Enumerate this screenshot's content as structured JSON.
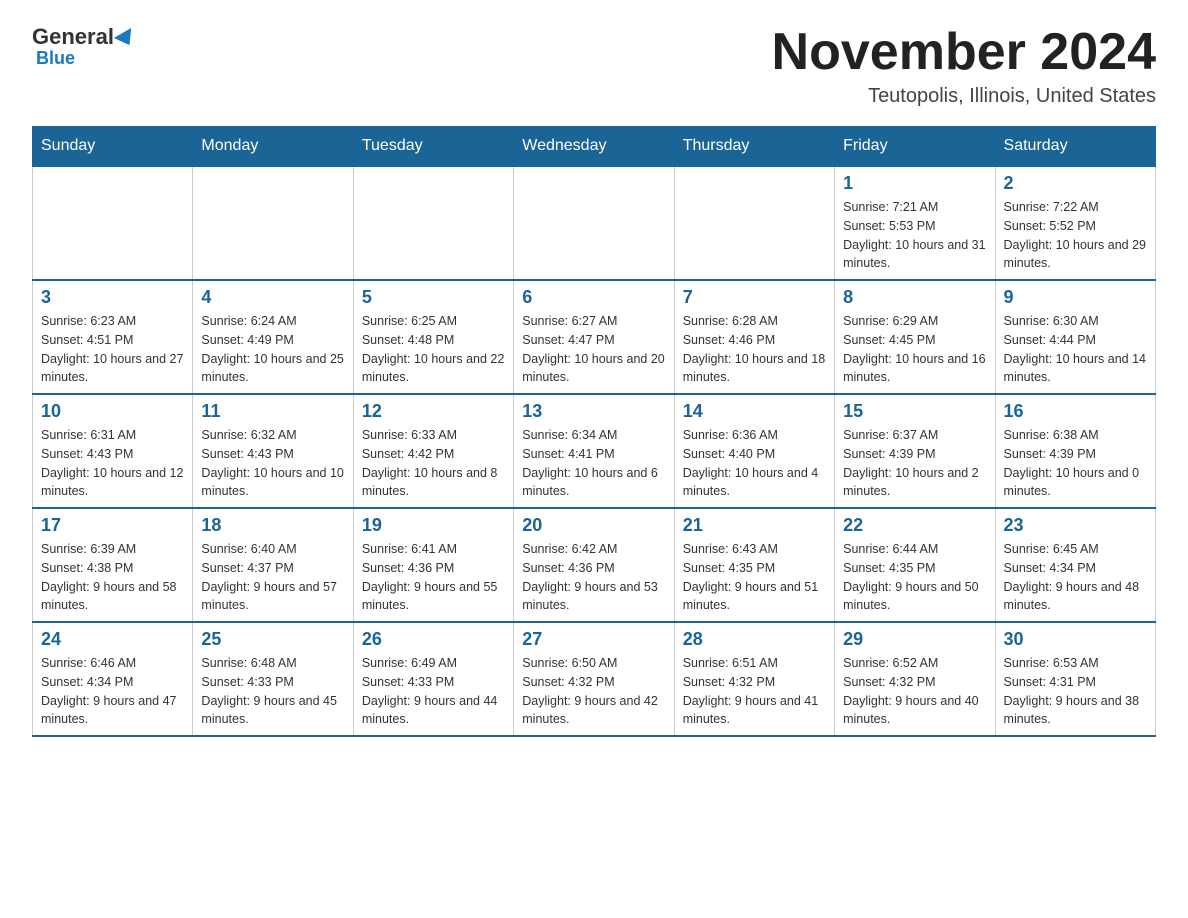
{
  "header": {
    "logo_general": "General",
    "logo_blue": "Blue",
    "month_title": "November 2024",
    "location": "Teutopolis, Illinois, United States"
  },
  "days_of_week": [
    "Sunday",
    "Monday",
    "Tuesday",
    "Wednesday",
    "Thursday",
    "Friday",
    "Saturday"
  ],
  "weeks": [
    [
      {
        "day": "",
        "info": ""
      },
      {
        "day": "",
        "info": ""
      },
      {
        "day": "",
        "info": ""
      },
      {
        "day": "",
        "info": ""
      },
      {
        "day": "",
        "info": ""
      },
      {
        "day": "1",
        "info": "Sunrise: 7:21 AM\nSunset: 5:53 PM\nDaylight: 10 hours and 31 minutes."
      },
      {
        "day": "2",
        "info": "Sunrise: 7:22 AM\nSunset: 5:52 PM\nDaylight: 10 hours and 29 minutes."
      }
    ],
    [
      {
        "day": "3",
        "info": "Sunrise: 6:23 AM\nSunset: 4:51 PM\nDaylight: 10 hours and 27 minutes."
      },
      {
        "day": "4",
        "info": "Sunrise: 6:24 AM\nSunset: 4:49 PM\nDaylight: 10 hours and 25 minutes."
      },
      {
        "day": "5",
        "info": "Sunrise: 6:25 AM\nSunset: 4:48 PM\nDaylight: 10 hours and 22 minutes."
      },
      {
        "day": "6",
        "info": "Sunrise: 6:27 AM\nSunset: 4:47 PM\nDaylight: 10 hours and 20 minutes."
      },
      {
        "day": "7",
        "info": "Sunrise: 6:28 AM\nSunset: 4:46 PM\nDaylight: 10 hours and 18 minutes."
      },
      {
        "day": "8",
        "info": "Sunrise: 6:29 AM\nSunset: 4:45 PM\nDaylight: 10 hours and 16 minutes."
      },
      {
        "day": "9",
        "info": "Sunrise: 6:30 AM\nSunset: 4:44 PM\nDaylight: 10 hours and 14 minutes."
      }
    ],
    [
      {
        "day": "10",
        "info": "Sunrise: 6:31 AM\nSunset: 4:43 PM\nDaylight: 10 hours and 12 minutes."
      },
      {
        "day": "11",
        "info": "Sunrise: 6:32 AM\nSunset: 4:43 PM\nDaylight: 10 hours and 10 minutes."
      },
      {
        "day": "12",
        "info": "Sunrise: 6:33 AM\nSunset: 4:42 PM\nDaylight: 10 hours and 8 minutes."
      },
      {
        "day": "13",
        "info": "Sunrise: 6:34 AM\nSunset: 4:41 PM\nDaylight: 10 hours and 6 minutes."
      },
      {
        "day": "14",
        "info": "Sunrise: 6:36 AM\nSunset: 4:40 PM\nDaylight: 10 hours and 4 minutes."
      },
      {
        "day": "15",
        "info": "Sunrise: 6:37 AM\nSunset: 4:39 PM\nDaylight: 10 hours and 2 minutes."
      },
      {
        "day": "16",
        "info": "Sunrise: 6:38 AM\nSunset: 4:39 PM\nDaylight: 10 hours and 0 minutes."
      }
    ],
    [
      {
        "day": "17",
        "info": "Sunrise: 6:39 AM\nSunset: 4:38 PM\nDaylight: 9 hours and 58 minutes."
      },
      {
        "day": "18",
        "info": "Sunrise: 6:40 AM\nSunset: 4:37 PM\nDaylight: 9 hours and 57 minutes."
      },
      {
        "day": "19",
        "info": "Sunrise: 6:41 AM\nSunset: 4:36 PM\nDaylight: 9 hours and 55 minutes."
      },
      {
        "day": "20",
        "info": "Sunrise: 6:42 AM\nSunset: 4:36 PM\nDaylight: 9 hours and 53 minutes."
      },
      {
        "day": "21",
        "info": "Sunrise: 6:43 AM\nSunset: 4:35 PM\nDaylight: 9 hours and 51 minutes."
      },
      {
        "day": "22",
        "info": "Sunrise: 6:44 AM\nSunset: 4:35 PM\nDaylight: 9 hours and 50 minutes."
      },
      {
        "day": "23",
        "info": "Sunrise: 6:45 AM\nSunset: 4:34 PM\nDaylight: 9 hours and 48 minutes."
      }
    ],
    [
      {
        "day": "24",
        "info": "Sunrise: 6:46 AM\nSunset: 4:34 PM\nDaylight: 9 hours and 47 minutes."
      },
      {
        "day": "25",
        "info": "Sunrise: 6:48 AM\nSunset: 4:33 PM\nDaylight: 9 hours and 45 minutes."
      },
      {
        "day": "26",
        "info": "Sunrise: 6:49 AM\nSunset: 4:33 PM\nDaylight: 9 hours and 44 minutes."
      },
      {
        "day": "27",
        "info": "Sunrise: 6:50 AM\nSunset: 4:32 PM\nDaylight: 9 hours and 42 minutes."
      },
      {
        "day": "28",
        "info": "Sunrise: 6:51 AM\nSunset: 4:32 PM\nDaylight: 9 hours and 41 minutes."
      },
      {
        "day": "29",
        "info": "Sunrise: 6:52 AM\nSunset: 4:32 PM\nDaylight: 9 hours and 40 minutes."
      },
      {
        "day": "30",
        "info": "Sunrise: 6:53 AM\nSunset: 4:31 PM\nDaylight: 9 hours and 38 minutes."
      }
    ]
  ]
}
